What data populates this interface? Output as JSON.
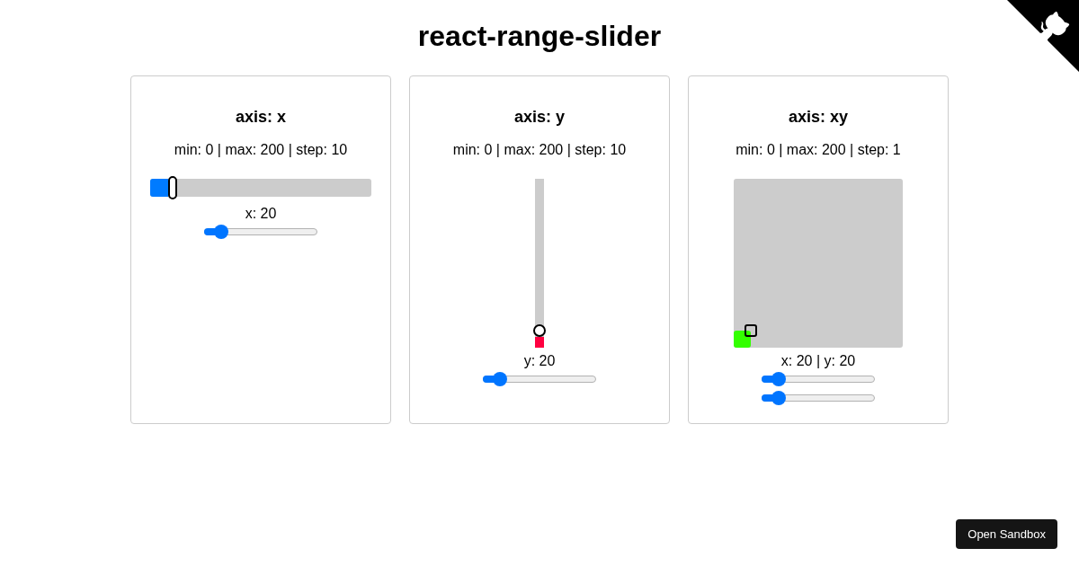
{
  "title": "react-range-slider",
  "cards": [
    {
      "kind": "x",
      "heading": "axis: x",
      "info": "min: 0 | max: 200 | step: 10",
      "slider": {
        "x": {
          "level": 0.1
        }
      },
      "readout": "x: 20",
      "range_inputs": [
        {
          "level": 0.1
        }
      ]
    },
    {
      "kind": "y",
      "heading": "axis: y",
      "info": "min: 0 | max: 200 | step: 10",
      "slider": {
        "y": {
          "level": 0.1
        }
      },
      "readout": "y: 20",
      "range_inputs": [
        {
          "level": 0.1
        }
      ]
    },
    {
      "kind": "xy",
      "heading": "axis: xy",
      "info": "min: 0 | max: 200 | step: 1",
      "slider": {
        "x": {
          "level": 0.1
        },
        "y": {
          "level": 0.1
        }
      },
      "readout": "x: 20 | y: 20",
      "range_inputs": [
        {
          "level": 0.1
        },
        {
          "level": 0.1
        }
      ]
    }
  ],
  "open_sandbox_button": "Open Sandbox"
}
